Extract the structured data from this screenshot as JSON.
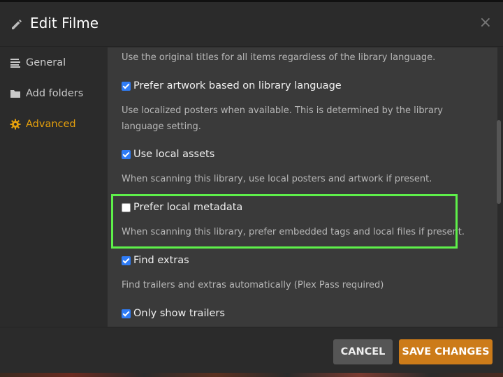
{
  "header": {
    "title": "Edit Filme",
    "close_label": "×"
  },
  "sidebar": {
    "items": [
      {
        "label": "General",
        "icon": "list-icon",
        "active": false
      },
      {
        "label": "Add folders",
        "icon": "folder-icon",
        "active": false
      },
      {
        "label": "Advanced",
        "icon": "gear-icon",
        "active": true
      }
    ]
  },
  "content": {
    "top_desc": "Use the original titles for all items regardless of the library language.",
    "options": [
      {
        "label": "Prefer artwork based on library language",
        "checked": true,
        "desc": "Use localized posters when available. This is determined by the library language setting."
      },
      {
        "label": "Use local assets",
        "checked": true,
        "desc": "When scanning this library, use local posters and artwork if present."
      },
      {
        "label": "Prefer local metadata",
        "checked": false,
        "desc": "When scanning this library, prefer embedded tags and local files if present."
      },
      {
        "label": "Find extras",
        "checked": true,
        "desc": "Find trailers and extras automatically (Plex Pass required)"
      },
      {
        "label": "Only show trailers",
        "checked": true,
        "desc": ""
      }
    ]
  },
  "footer": {
    "cancel_label": "CANCEL",
    "save_label": "SAVE CHANGES"
  },
  "colors": {
    "accent": "#e5a00d",
    "save_button": "#cc7b19",
    "highlight": "#5ef04a",
    "checkbox": "#2f7cf6"
  }
}
